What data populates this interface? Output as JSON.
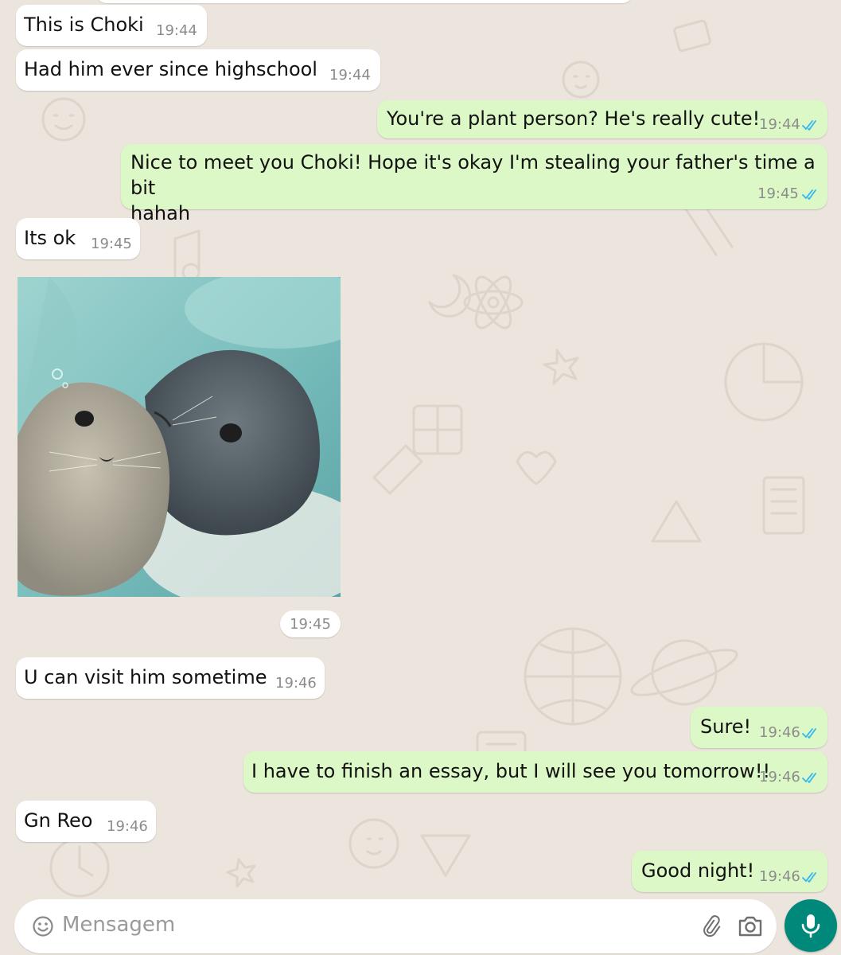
{
  "messages": [
    {
      "text": "This is Choki",
      "time": "19:44",
      "dir": "in"
    },
    {
      "text": "Had him ever since highschool",
      "time": "19:44",
      "dir": "in"
    },
    {
      "text": "You're a plant person? He's really cute!",
      "time": "19:44",
      "dir": "out",
      "read": true
    },
    {
      "text": "Nice to meet you Choki! Hope it's okay I'm stealing your father's time a bit\nhahah",
      "time": "19:45",
      "dir": "out",
      "read": true
    },
    {
      "text": "Its ok",
      "time": "19:45",
      "dir": "in"
    },
    {
      "image": "photo of two seals touching noses underwater",
      "time": "19:45",
      "dir": "in"
    },
    {
      "text": "U can visit him sometime",
      "time": "19:46",
      "dir": "in"
    },
    {
      "text": "Sure!",
      "time": "19:46",
      "dir": "out",
      "read": true
    },
    {
      "text": "I have to finish an essay, but I will see you tomorrow!!",
      "time": "19:46",
      "dir": "out",
      "read": true
    },
    {
      "text": "Gn Reo",
      "time": "19:46",
      "dir": "in"
    },
    {
      "text": "Good night!",
      "time": "19:46",
      "dir": "out",
      "read": true
    }
  ],
  "composer": {
    "placeholder": "Mensagem",
    "icons": [
      "emoji-icon",
      "paperclip-icon",
      "camera-icon",
      "microphone-icon"
    ]
  },
  "colors": {
    "background": "#ece5dd",
    "incoming": "#ffffff",
    "outgoing": "#dcf8c6",
    "read_ticks": "#34b7f1",
    "accent": "#00897b"
  }
}
